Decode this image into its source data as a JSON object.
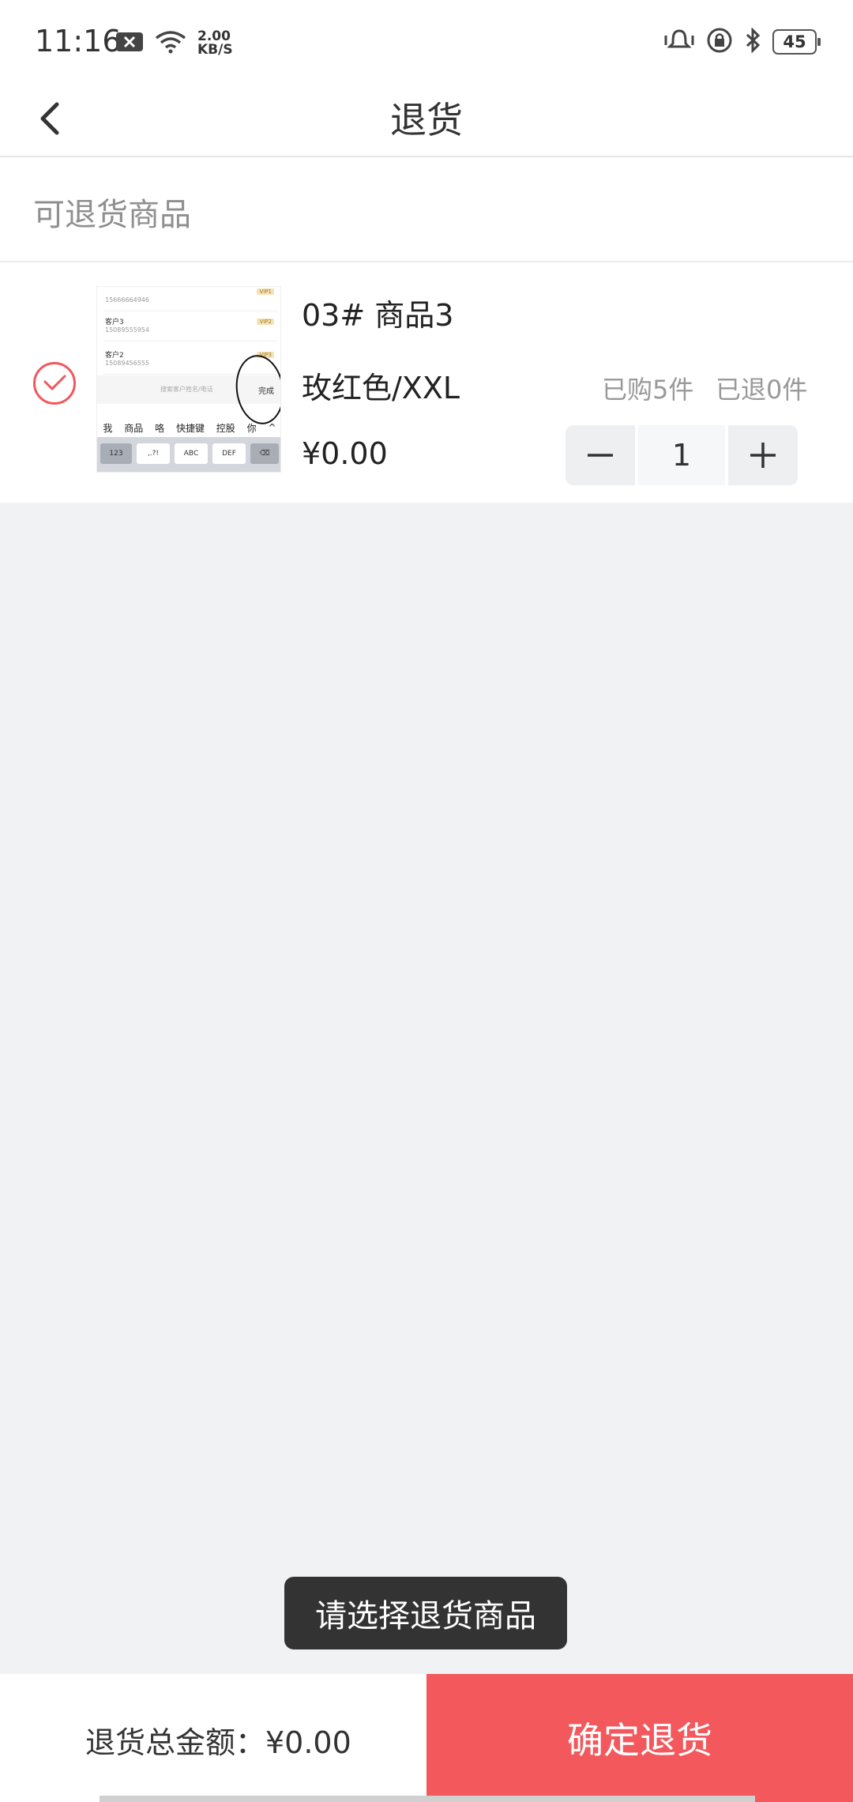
{
  "status_bar": {
    "time": "11:16",
    "net_speed_value": "2.00",
    "net_speed_unit": "KB/S",
    "battery": "45"
  },
  "header": {
    "title": "退货"
  },
  "section": {
    "label": "可退货商品"
  },
  "product": {
    "selected": true,
    "name": "03# 商品3",
    "spec": "玫红色/XXL",
    "price": "¥0.00",
    "purchased": "已购5件",
    "returned": "已退0件",
    "quantity": "1",
    "thumbnail": {
      "rows": [
        {
          "name": "",
          "phone": "15666664946",
          "tag": "VIP1"
        },
        {
          "name": "客户3",
          "phone": "15089555954",
          "tag": "VIP2"
        },
        {
          "name": "客户2",
          "phone": "15089456555",
          "tag": "VIP3"
        }
      ],
      "search_placeholder": "搜索客户姓名/电话",
      "done_label": "完成",
      "candidates": [
        "我",
        "商品",
        "咯",
        "快捷键",
        "控股",
        "你",
        "^"
      ],
      "keys": [
        "123",
        ",.?!",
        "ABC",
        "DEF",
        "⌫"
      ]
    }
  },
  "toast": {
    "text": "请选择退货商品"
  },
  "footer": {
    "total_label": "退货总金额：¥0.00",
    "confirm_label": "确定退货"
  },
  "colors": {
    "accent": "#f2585c",
    "background": "#f1f2f4"
  }
}
